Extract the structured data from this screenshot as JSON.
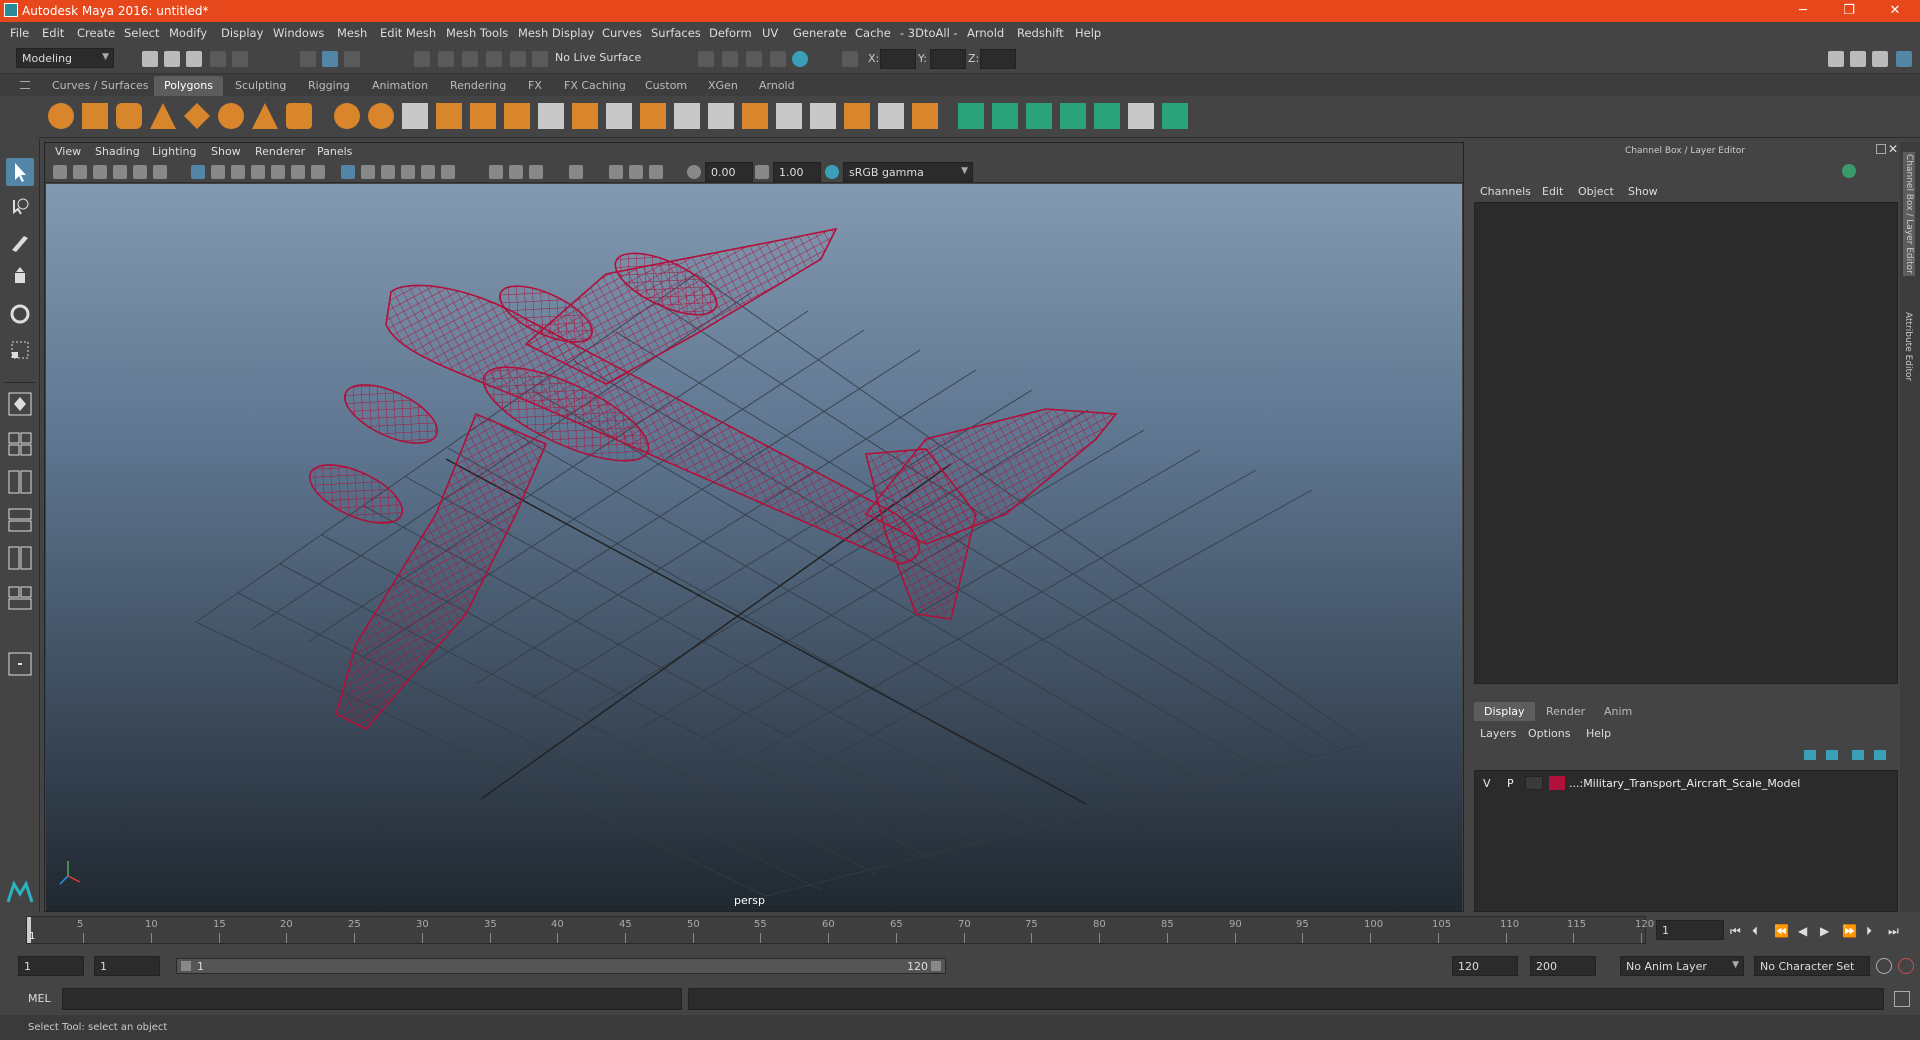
{
  "title_bar": {
    "title": "Autodesk Maya 2016: untitled*",
    "minimize": "─",
    "maximize": "❐",
    "close": "✕"
  },
  "menubar": {
    "items": [
      "File",
      "Edit",
      "Create",
      "Select",
      "Modify",
      "Display",
      "Windows",
      "Mesh",
      "Edit Mesh",
      "Mesh Tools",
      "Mesh Display",
      "Curves",
      "Surfaces",
      "Deform",
      "UV",
      "Generate",
      "Cache",
      "- 3DtoAll -",
      "Arnold",
      "Redshift",
      "Help"
    ]
  },
  "status_line": {
    "menu_set": "Modeling",
    "live_surface": "No Live Surface",
    "x_label": "X:",
    "y_label": "Y:",
    "z_label": "Z:"
  },
  "shelf": {
    "tabs": [
      "Curves / Surfaces",
      "Polygons",
      "Sculpting",
      "Rigging",
      "Animation",
      "Rendering",
      "FX",
      "FX Caching",
      "Custom",
      "XGen",
      "Arnold"
    ],
    "active_tab": "Polygons"
  },
  "viewport_panel": {
    "menus": [
      "View",
      "Shading",
      "Lighting",
      "Show",
      "Renderer",
      "Panels"
    ],
    "exposure": "0.00",
    "gamma": "1.00",
    "color_space": "sRGB gamma",
    "camera_label": "persp"
  },
  "channel_box": {
    "header": "Channel Box / Layer Editor",
    "menus": [
      "Channels",
      "Edit",
      "Object",
      "Show"
    ],
    "layer_tabs": [
      "Display",
      "Render",
      "Anim"
    ],
    "active_layer_tab": "Display",
    "layer_menus": [
      "Layers",
      "Options",
      "Help"
    ],
    "layers": [
      {
        "visible": "V",
        "playback": "P",
        "name": "...:Military_Transport_Aircraft_Scale_Model",
        "color": "#b0103a"
      }
    ]
  },
  "side_tabs": [
    "Channel Box / Layer Editor",
    "Attribute Editor"
  ],
  "time_slider": {
    "ticks": [
      "5",
      "10",
      "15",
      "20",
      "25",
      "30",
      "35",
      "40",
      "45",
      "50",
      "55",
      "60",
      "65",
      "70",
      "75",
      "80",
      "85",
      "90",
      "95",
      "100",
      "105",
      "110",
      "115",
      "120"
    ],
    "current_frame": "1",
    "start_marker": "1"
  },
  "range_slider": {
    "start": "1",
    "playback_start": "1",
    "range_start_label": "1",
    "range_end_label": "120",
    "playback_end": "120",
    "end": "200",
    "anim_layer": "No Anim Layer",
    "character_set": "No Character Set"
  },
  "command_line": {
    "label": "MEL"
  },
  "help_line": {
    "text": "Select Tool: select an object"
  },
  "colors": {
    "title_bar": "#e6471b",
    "wireframe": "#b0103a",
    "active_tool": "#5285a6"
  }
}
